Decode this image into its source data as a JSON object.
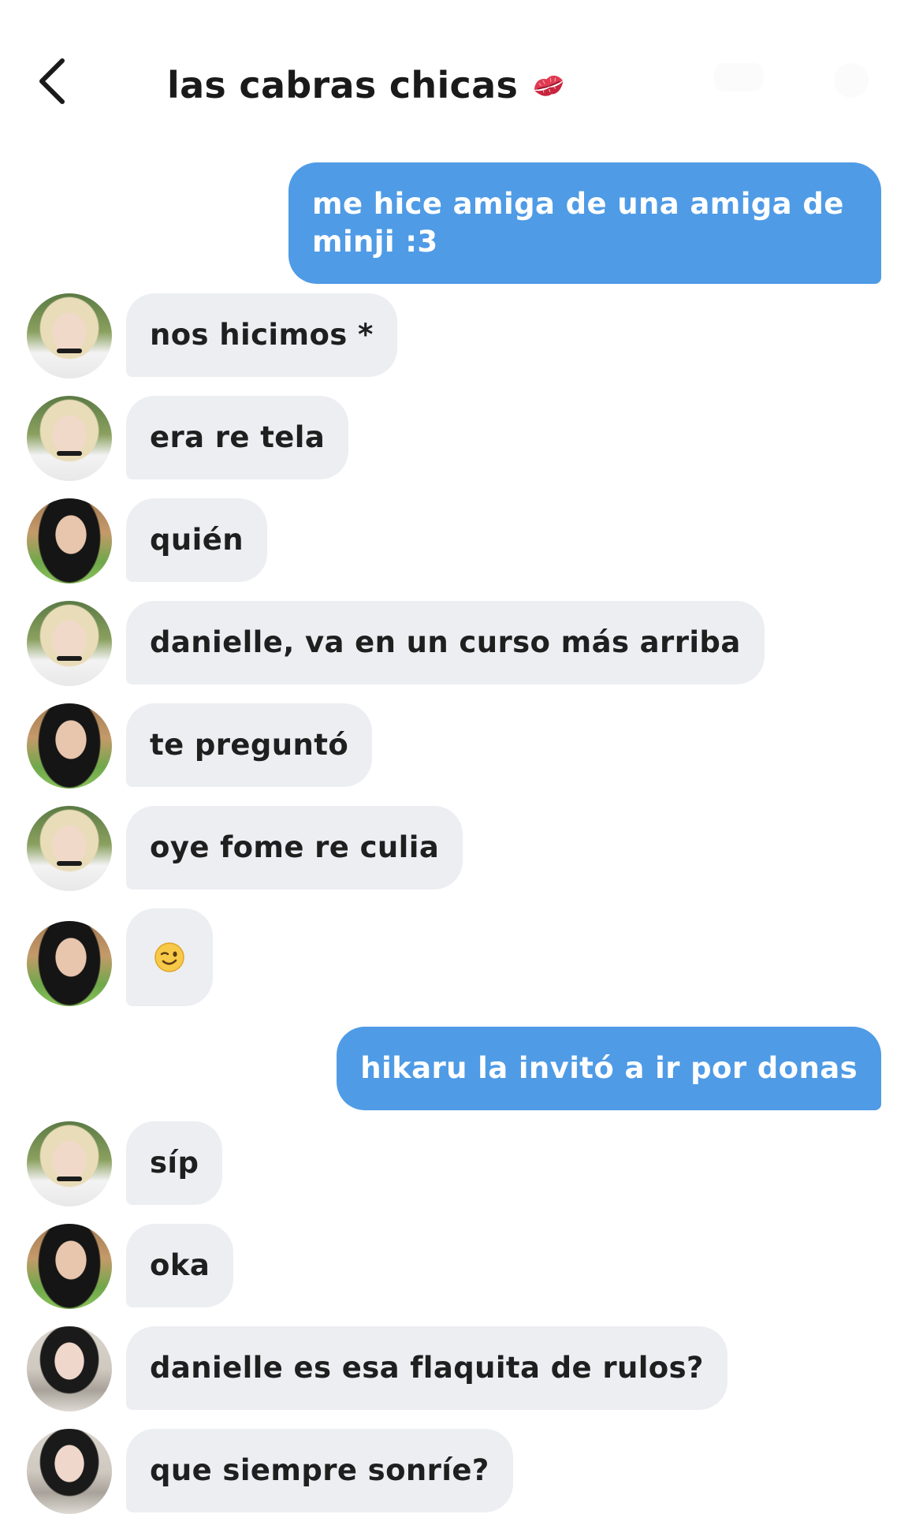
{
  "header": {
    "title": "las cabras chicas",
    "back_icon": "chevron-left-icon",
    "title_emoji": "kiss-mark-icon"
  },
  "colors": {
    "outgoing_bubble": "#4f9be6",
    "incoming_bubble": "#eceef2",
    "text_dark": "#1f1f1f"
  },
  "messages": [
    {
      "direction": "outgoing",
      "text": "me hice amiga de una amiga de minji :3"
    },
    {
      "direction": "incoming",
      "sender_avatar": "blonde",
      "text": "nos hicimos *"
    },
    {
      "direction": "incoming",
      "sender_avatar": "blonde",
      "text": "era re tela"
    },
    {
      "direction": "incoming",
      "sender_avatar": "dark-hair",
      "text": "quién"
    },
    {
      "direction": "incoming",
      "sender_avatar": "blonde",
      "text": "danielle, va en un curso más arriba"
    },
    {
      "direction": "incoming",
      "sender_avatar": "dark-hair",
      "text": "te preguntó"
    },
    {
      "direction": "incoming",
      "sender_avatar": "blonde",
      "text": "oye fome re culia"
    },
    {
      "direction": "incoming",
      "sender_avatar": "dark-hair",
      "emoji": "winking-face-icon"
    },
    {
      "direction": "outgoing",
      "text": "hikaru la invitó a ir por donas"
    },
    {
      "direction": "incoming",
      "sender_avatar": "blonde",
      "text": "síp"
    },
    {
      "direction": "incoming",
      "sender_avatar": "dark-hair",
      "text": "oka"
    },
    {
      "direction": "incoming",
      "sender_avatar": "curly",
      "text": "danielle es esa flaquita de rulos?"
    },
    {
      "direction": "incoming",
      "sender_avatar": "curly",
      "text": "que siempre sonríe?"
    }
  ]
}
